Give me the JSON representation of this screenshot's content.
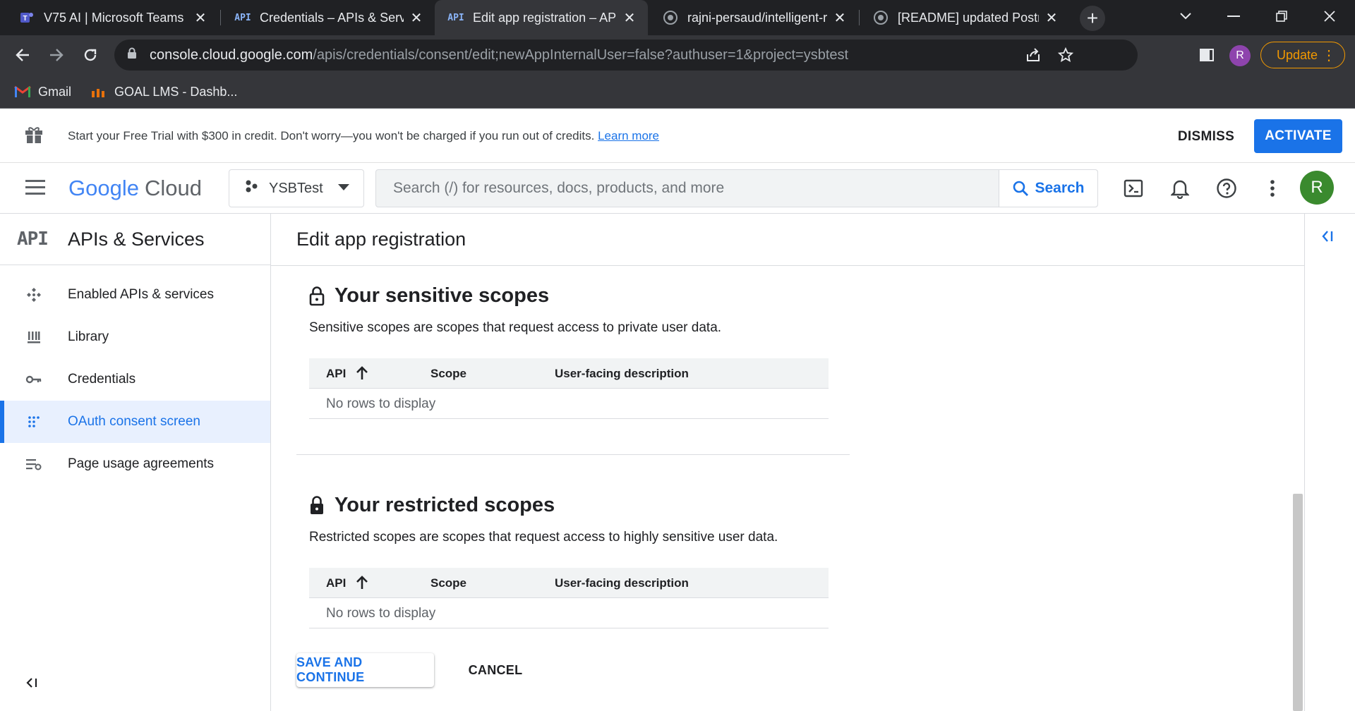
{
  "browser": {
    "tabs": [
      {
        "title": "V75 AI | Microsoft Teams",
        "icon": "teams-icon",
        "active": false
      },
      {
        "title": "Credentials – APIs & Servi",
        "icon": "api-icon",
        "active": false
      },
      {
        "title": "Edit app registration – AP",
        "icon": "api-icon",
        "active": true
      },
      {
        "title": "rajni-persaud/intelligent-r",
        "icon": "github-icon",
        "active": false
      },
      {
        "title": "[README] updated Postm",
        "icon": "github-icon",
        "active": false
      }
    ],
    "url_host": "console.cloud.google.com",
    "url_path": "/apis/credentials/consent/edit;newAppInternalUser=false?authuser=1&project=ysbtest",
    "profile_initial": "R",
    "update_label": "Update",
    "bookmarks": [
      {
        "label": "Gmail",
        "icon": "gmail-icon"
      },
      {
        "label": "GOAL LMS - Dashb...",
        "icon": "goal-lms-icon"
      }
    ]
  },
  "banner": {
    "message": "Start your Free Trial with $300 in credit. Don't worry—you won't be charged if you run out of credits.",
    "learn_more": "Learn more",
    "dismiss": "DISMISS",
    "activate": "ACTIVATE"
  },
  "header": {
    "logo_google": "Google",
    "logo_cloud": "Cloud",
    "project": "YSBTest",
    "search_placeholder": "Search (/) for resources, docs, products, and more",
    "search_button": "Search",
    "avatar_initial": "R"
  },
  "sidebar": {
    "logo": "API",
    "title": "APIs & Services",
    "items": [
      {
        "label": "Enabled APIs & services",
        "icon": "enabled-apis-icon",
        "active": false
      },
      {
        "label": "Library",
        "icon": "library-icon",
        "active": false
      },
      {
        "label": "Credentials",
        "icon": "key-icon",
        "active": false
      },
      {
        "label": "OAuth consent screen",
        "icon": "oauth-icon",
        "active": true
      },
      {
        "label": "Page usage agreements",
        "icon": "agreements-icon",
        "active": false
      }
    ]
  },
  "main": {
    "page_title": "Edit app registration",
    "sensitive": {
      "heading": "Your sensitive scopes",
      "description": "Sensitive scopes are scopes that request access to private user data.",
      "columns": [
        "API",
        "Scope",
        "User-facing description"
      ],
      "empty": "No rows to display"
    },
    "restricted": {
      "heading": "Your restricted scopes",
      "description": "Restricted scopes are scopes that request access to highly sensitive user data.",
      "columns": [
        "API",
        "Scope",
        "User-facing description"
      ],
      "empty": "No rows to display"
    },
    "save_button": "SAVE AND CONTINUE",
    "cancel_button": "CANCEL"
  },
  "colors": {
    "accent": "#1a73e8",
    "active_bg": "#e8f0fe",
    "update": "#f29900"
  }
}
